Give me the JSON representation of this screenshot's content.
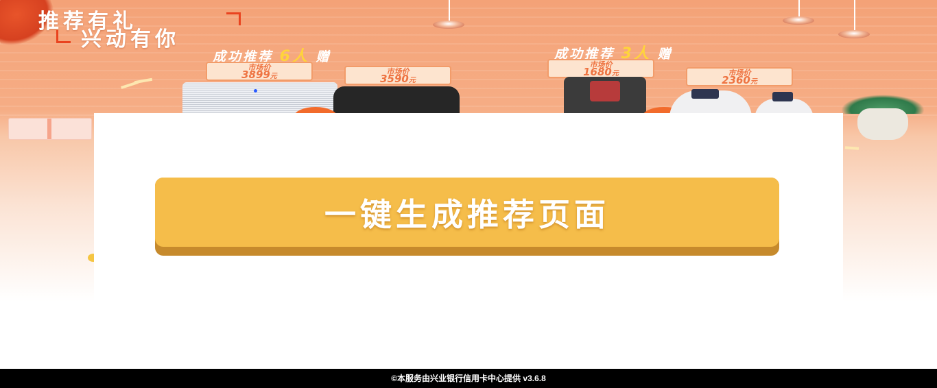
{
  "banner": {
    "title_line1": "推荐有礼",
    "title_line2": "兴动有你",
    "promo_left": {
      "prefix": "成功推荐",
      "count": "6人",
      "suffix": "赠"
    },
    "promo_right": {
      "prefix": "成功推荐",
      "count": "3人",
      "suffix": "赠"
    },
    "price_tags": [
      {
        "label": "市场价",
        "value": "3899",
        "unit": "元"
      },
      {
        "label": "市场价",
        "value": "3590",
        "unit": "元"
      },
      {
        "label": "市场价",
        "value": "1680",
        "unit": "元"
      },
      {
        "label": "市场价",
        "value": "2360",
        "unit": "元"
      }
    ]
  },
  "main": {
    "generate_button_label": "一键生成推荐页面"
  },
  "footer": {
    "text": "©本服务由兴业银行信用卡中心提供 v3.6.8"
  },
  "colors": {
    "banner_orange": "#f4a277",
    "button_yellow": "#f5bd4a",
    "button_shadow": "#c68a2c",
    "highlight_yellow": "#ffd43b",
    "footer_bg": "#000000"
  }
}
